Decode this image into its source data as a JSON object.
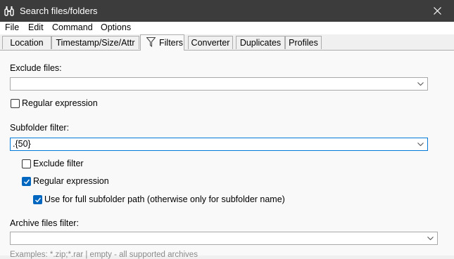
{
  "window": {
    "title": "Search files/folders",
    "app_icon": "binoculars-icon",
    "close_icon": "close-icon"
  },
  "menu": [
    "File",
    "Edit",
    "Command",
    "Options"
  ],
  "tabs": [
    {
      "label": "Location"
    },
    {
      "label": "Timestamp/Size/Attr"
    },
    {
      "label": "Filters",
      "icon": "filter-icon",
      "active": true
    },
    {
      "label": "Converter"
    },
    {
      "label": "Duplicates"
    },
    {
      "label": "Profiles"
    }
  ],
  "filters": {
    "exclude_files_label": "Exclude files:",
    "exclude_files_value": "",
    "exclude_regex_label": "Regular expression",
    "exclude_regex_checked": false,
    "subfolder_label": "Subfolder filter:",
    "subfolder_value": ".{50}",
    "exclude_filter_label": "Exclude filter",
    "exclude_filter_checked": false,
    "subfolder_regex_label": "Regular expression",
    "subfolder_regex_checked": true,
    "full_path_label": "Use for full subfolder path (otherwise only for subfolder name)",
    "full_path_checked": true,
    "archive_label": "Archive files filter:",
    "archive_value": "",
    "archive_hint": "Examples: *.zip;*.rar | empty - all supported archives"
  },
  "colors": {
    "accent": "#0067c0",
    "titlebar": "#3c3c3c",
    "panel": "#f9f9f9"
  }
}
